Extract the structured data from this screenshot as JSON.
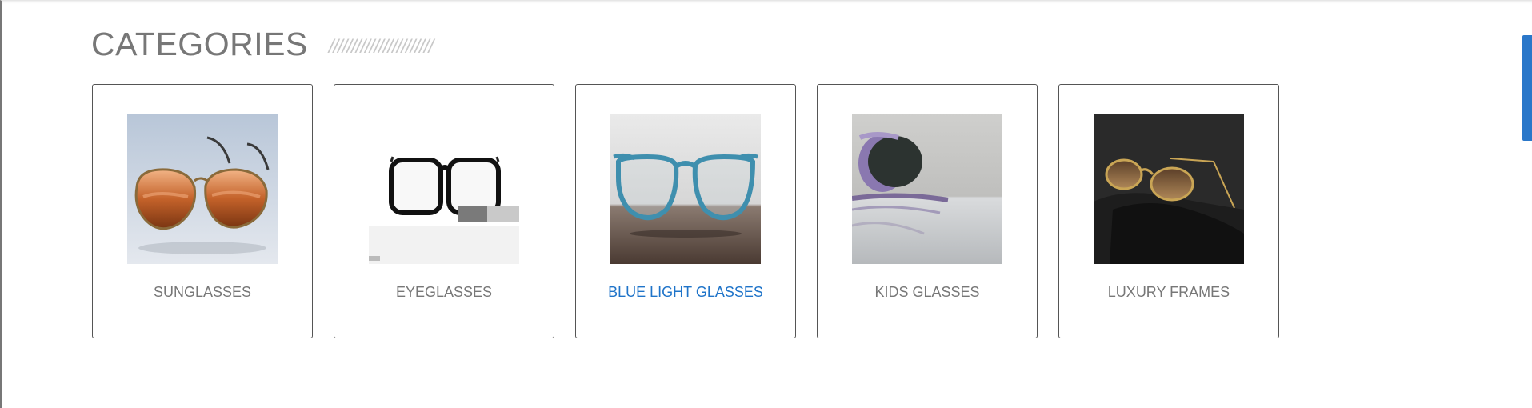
{
  "section": {
    "title": "CATEGORIES",
    "decoration": "///////////////////////"
  },
  "categories": [
    {
      "label": "SUNGLASSES",
      "icon": "aviator-sunglasses-image",
      "active": false
    },
    {
      "label": "EYEGLASSES",
      "icon": "black-eyeglasses-image",
      "active": false
    },
    {
      "label": "BLUE LIGHT GLASSES",
      "icon": "blue-light-glasses-image",
      "active": true
    },
    {
      "label": "KIDS GLASSES",
      "icon": "kids-glasses-image",
      "active": false
    },
    {
      "label": "LUXURY FRAMES",
      "icon": "gold-frames-image",
      "active": false
    }
  ],
  "colors": {
    "heading": "#777777",
    "label": "#777777",
    "active_label": "#1f74c9",
    "scrollbar": "#2a77c9"
  }
}
